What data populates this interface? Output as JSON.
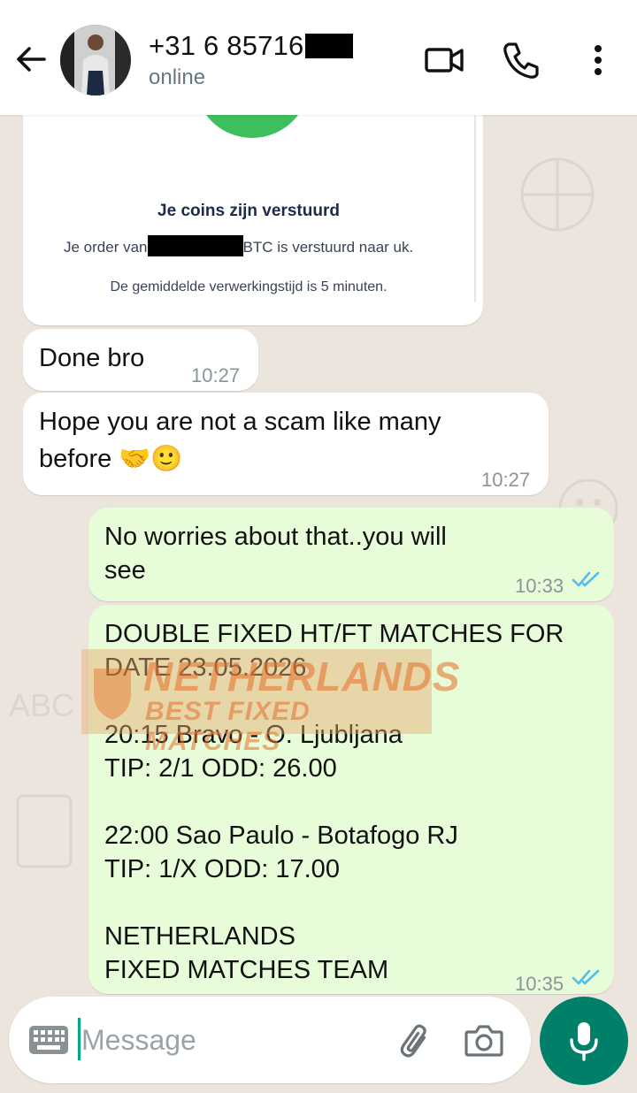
{
  "header": {
    "contact_name": "+31 6 85716",
    "status": "online"
  },
  "image_message": {
    "title": "Je coins zijn verstuurd",
    "order_prefix": "Je order van",
    "order_suffix": "BTC is verstuurd naar uk.",
    "note": "De gemiddelde verwerkingstijd is 5 minuten."
  },
  "messages": [
    {
      "direction": "in",
      "text": "Done bro",
      "time": "10:27"
    },
    {
      "direction": "in",
      "text": "Hope you are not a scam like many before 🤝🙂",
      "line1": "Hope you are not a scam like many",
      "line2": "before",
      "emoji": "🤝🙂",
      "time": "10:27"
    },
    {
      "direction": "out",
      "line1": "No worries about that..you will",
      "line2": "see",
      "time": "10:33",
      "status": "read"
    },
    {
      "direction": "out",
      "lines": [
        "DOUBLE FIXED HT/FT MATCHES FOR",
        "DATE 23.05.2026",
        "",
        "20:15  Bravo - O. Ljubljana",
        "TIP: 2/1  ODD: 26.00",
        "",
        "22:00  Sao Paulo - Botafogo RJ",
        "TIP: 1/X  ODD: 17.00",
        "",
        "NETHERLANDS",
        "FIXED MATCHES TEAM"
      ],
      "time": "10:35",
      "status": "read"
    }
  ],
  "watermark": {
    "line1": "NETHERLANDS",
    "line2": "BEST FIXED MATCHES"
  },
  "composer": {
    "placeholder": "Message"
  },
  "colors": {
    "outgoing_bubble": "#e7fcd8",
    "incoming_bubble": "#ffffff",
    "accent": "#008069",
    "read_ticks": "#53bdeb"
  }
}
